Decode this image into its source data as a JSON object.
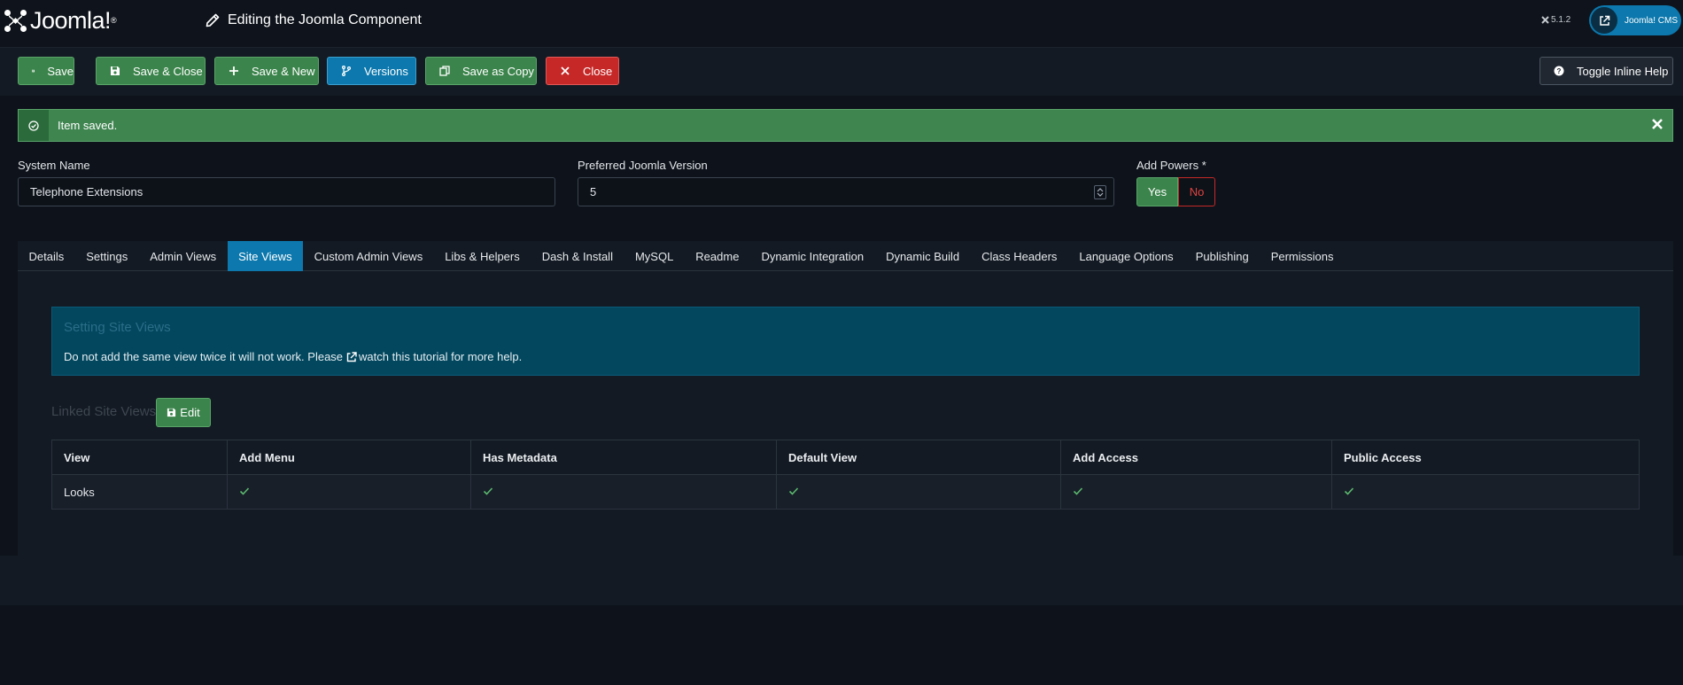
{
  "header": {
    "logo_text": "Joomla!",
    "logo_mark": "®",
    "page_title": "Editing the Joomla Component",
    "version": "5.1.2",
    "site_link": "Joomla! CMS"
  },
  "toolbar": {
    "save": "Save",
    "save_close": "Save & Close",
    "save_new": "Save & New",
    "versions": "Versions",
    "save_copy": "Save as Copy",
    "close": "Close",
    "toggle_help": "Toggle Inline Help"
  },
  "alert": {
    "message": "Item saved."
  },
  "form": {
    "system_name_label": "System Name",
    "system_name_value": "Telephone Extensions",
    "joomla_version_label": "Preferred Joomla Version",
    "joomla_version_value": "5",
    "add_powers_label": "Add Powers *",
    "add_powers_yes": "Yes",
    "add_powers_no": "No"
  },
  "tabs": [
    {
      "label": "Details"
    },
    {
      "label": "Settings"
    },
    {
      "label": "Admin Views"
    },
    {
      "label": "Site Views"
    },
    {
      "label": "Custom Admin Views"
    },
    {
      "label": "Libs & Helpers"
    },
    {
      "label": "Dash & Install"
    },
    {
      "label": "MySQL"
    },
    {
      "label": "Readme"
    },
    {
      "label": "Dynamic Integration"
    },
    {
      "label": "Dynamic Build"
    },
    {
      "label": "Class Headers"
    },
    {
      "label": "Language Options"
    },
    {
      "label": "Publishing"
    },
    {
      "label": "Permissions"
    }
  ],
  "active_tab": "Site Views",
  "site_views": {
    "info_title": "Setting Site Views",
    "info_text_before": "Do not add the same view twice it will not work. Please",
    "info_link": "watch this tutorial for more help.",
    "linked_label": "Linked Site Views",
    "edit_button": "Edit",
    "columns": [
      "View",
      "Add Menu",
      "Has Metadata",
      "Default View",
      "Add Access",
      "Public Access"
    ],
    "rows": [
      {
        "view": "Looks",
        "add_menu": true,
        "has_metadata": true,
        "default_view": true,
        "add_access": true,
        "public_access": true
      }
    ]
  },
  "colors": {
    "success": "#3b844b",
    "primary": "#0c78ad",
    "danger": "#c52827",
    "info_bg": "#02475e"
  }
}
